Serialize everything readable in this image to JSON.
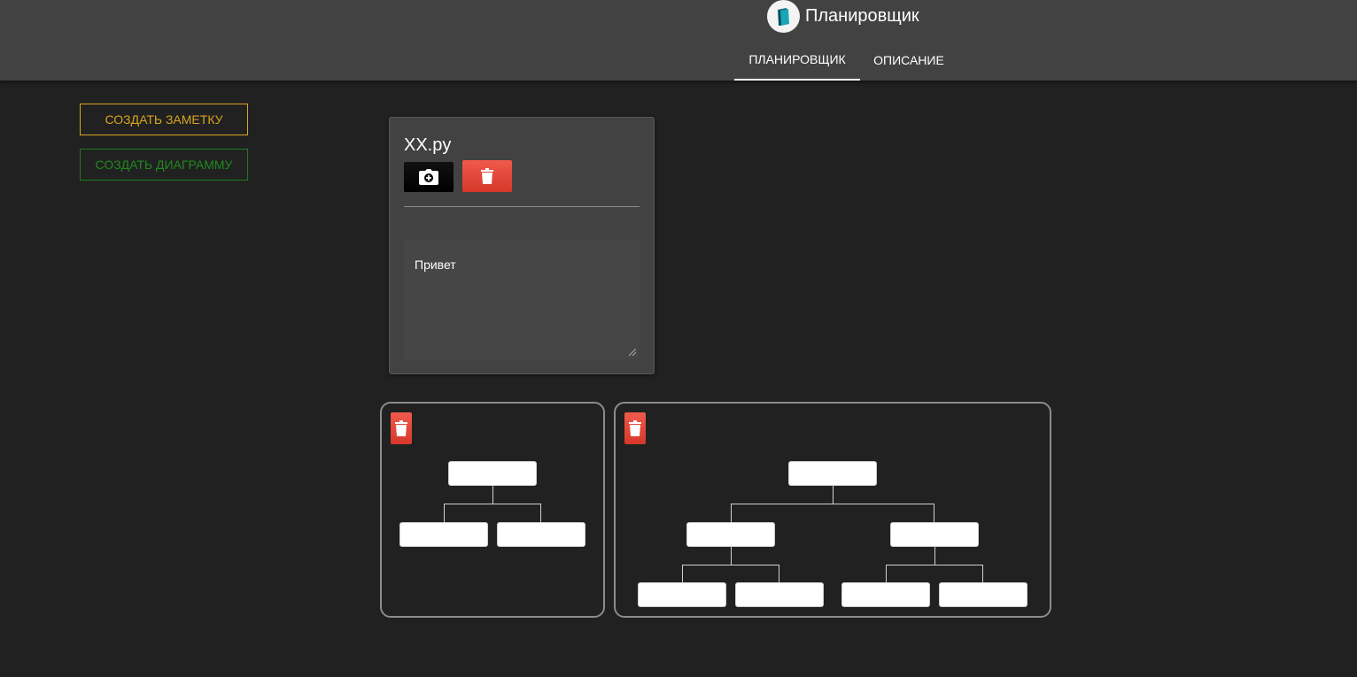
{
  "header": {
    "title": "Планировщик",
    "logo_icon": "book-logo-icon",
    "tabs": [
      {
        "label": "Планировщик",
        "active": true
      },
      {
        "label": "Описание",
        "active": false
      }
    ]
  },
  "sidebar": {
    "create_note_label": "Создать заметку",
    "create_diagram_label": "Создать диаграмму",
    "note_color": "#d9a41f",
    "diagram_color": "#1f8a1f"
  },
  "note": {
    "title": "XX.py",
    "text": "Привет",
    "camera_icon": "camera-plus-icon",
    "delete_icon": "trash-icon",
    "delete_color": "#e5463a"
  },
  "diagrams": [
    {
      "delete_icon": "trash-icon",
      "root_children": 2,
      "grandchildren": 0
    },
    {
      "delete_icon": "trash-icon",
      "root_children": 2,
      "grandchildren": 4
    }
  ]
}
